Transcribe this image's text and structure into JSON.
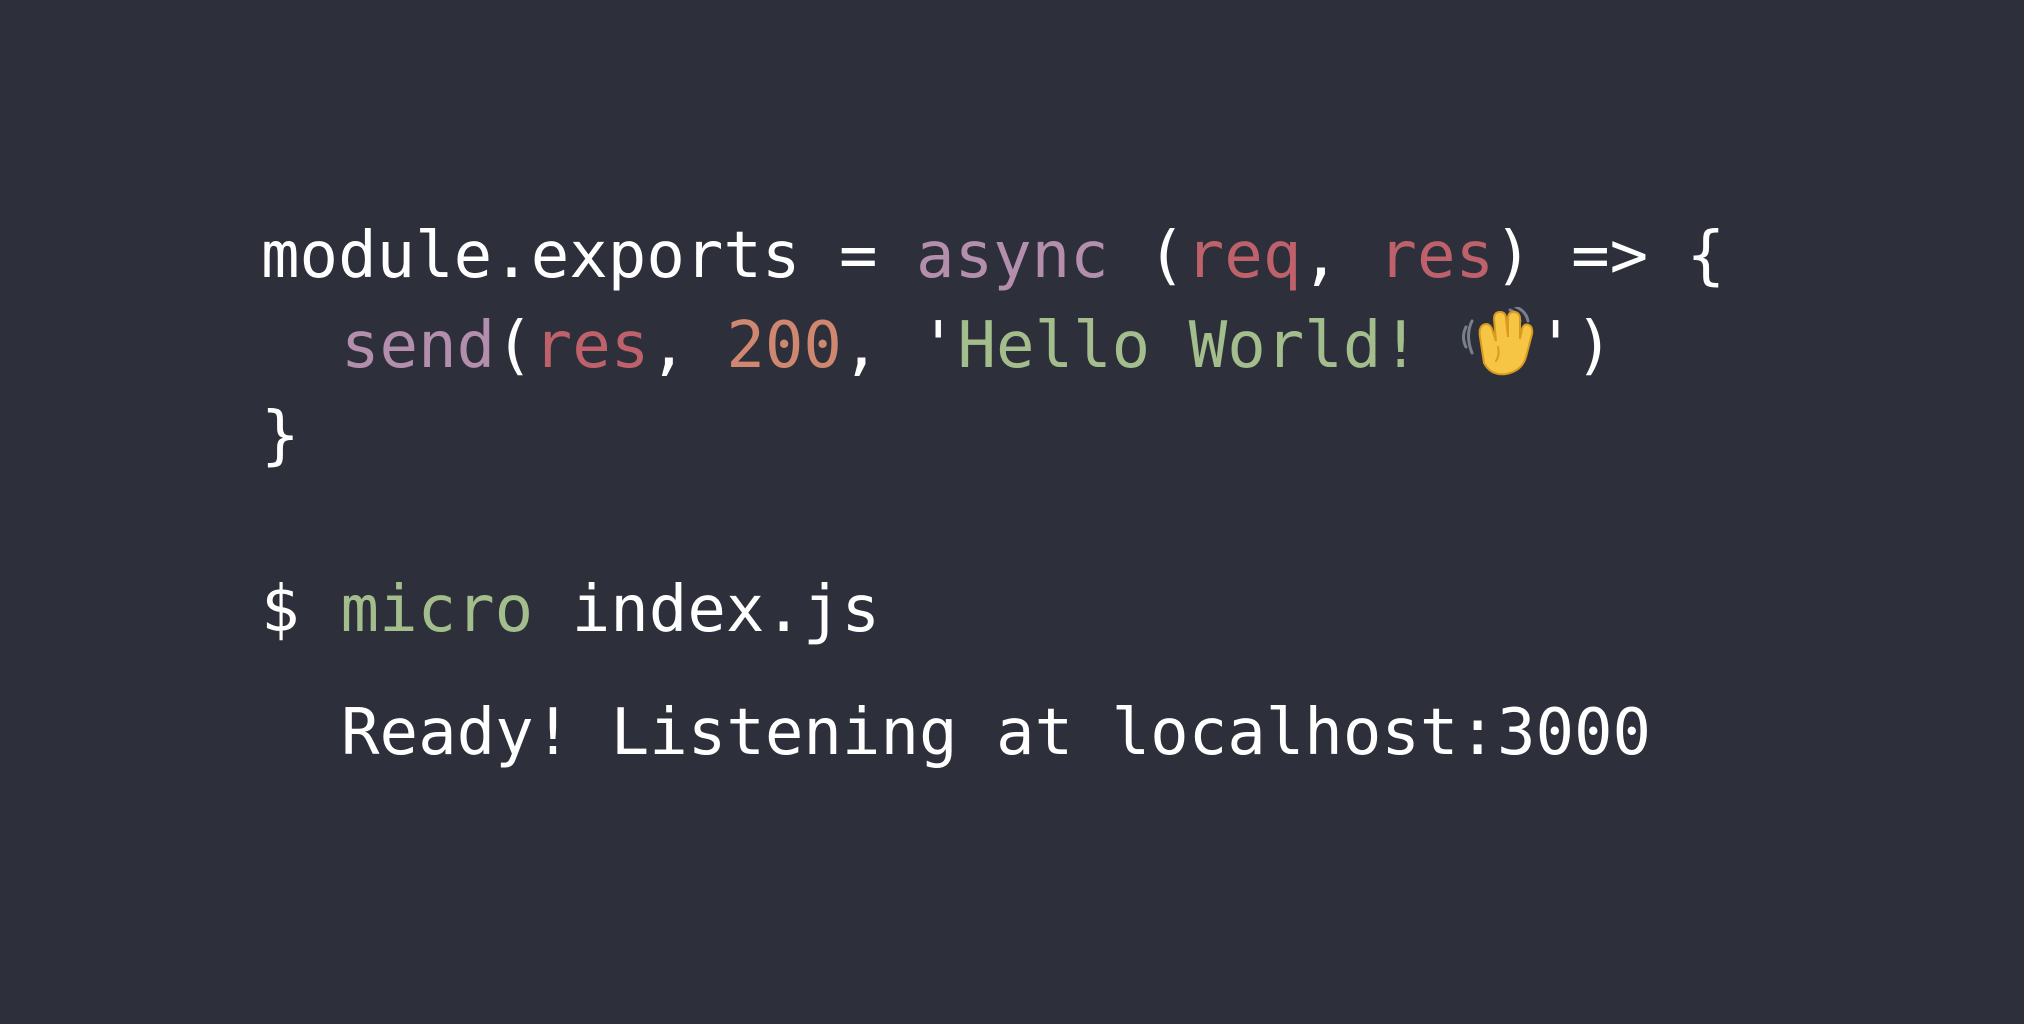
{
  "colors": {
    "background": "#2d303b",
    "text": "#ffffff",
    "keyword": "#b48ead",
    "parameter": "#bf616a",
    "number": "#d08770",
    "string": "#a3be8c",
    "command": "#a3be8c"
  },
  "code": {
    "line1": {
      "module_exports": "module.exports",
      "assign": " = ",
      "async": "async",
      "open_paren_space": " (",
      "req": "req",
      "comma1": ", ",
      "res": "res",
      "arrow": ") => {"
    },
    "line2": {
      "send": "send",
      "open_paren": "(",
      "res": "res",
      "comma1": ", ",
      "status": "200",
      "comma2": ", ",
      "quote_open": "'",
      "message": "Hello World! ",
      "emoji": "waving-hand-icon",
      "quote_close_paren": "')"
    },
    "line3": {
      "close_brace": "}"
    }
  },
  "terminal": {
    "prompt": "$",
    "command": "micro",
    "argument": " index.js",
    "output": "Ready! Listening at localhost:3000"
  }
}
